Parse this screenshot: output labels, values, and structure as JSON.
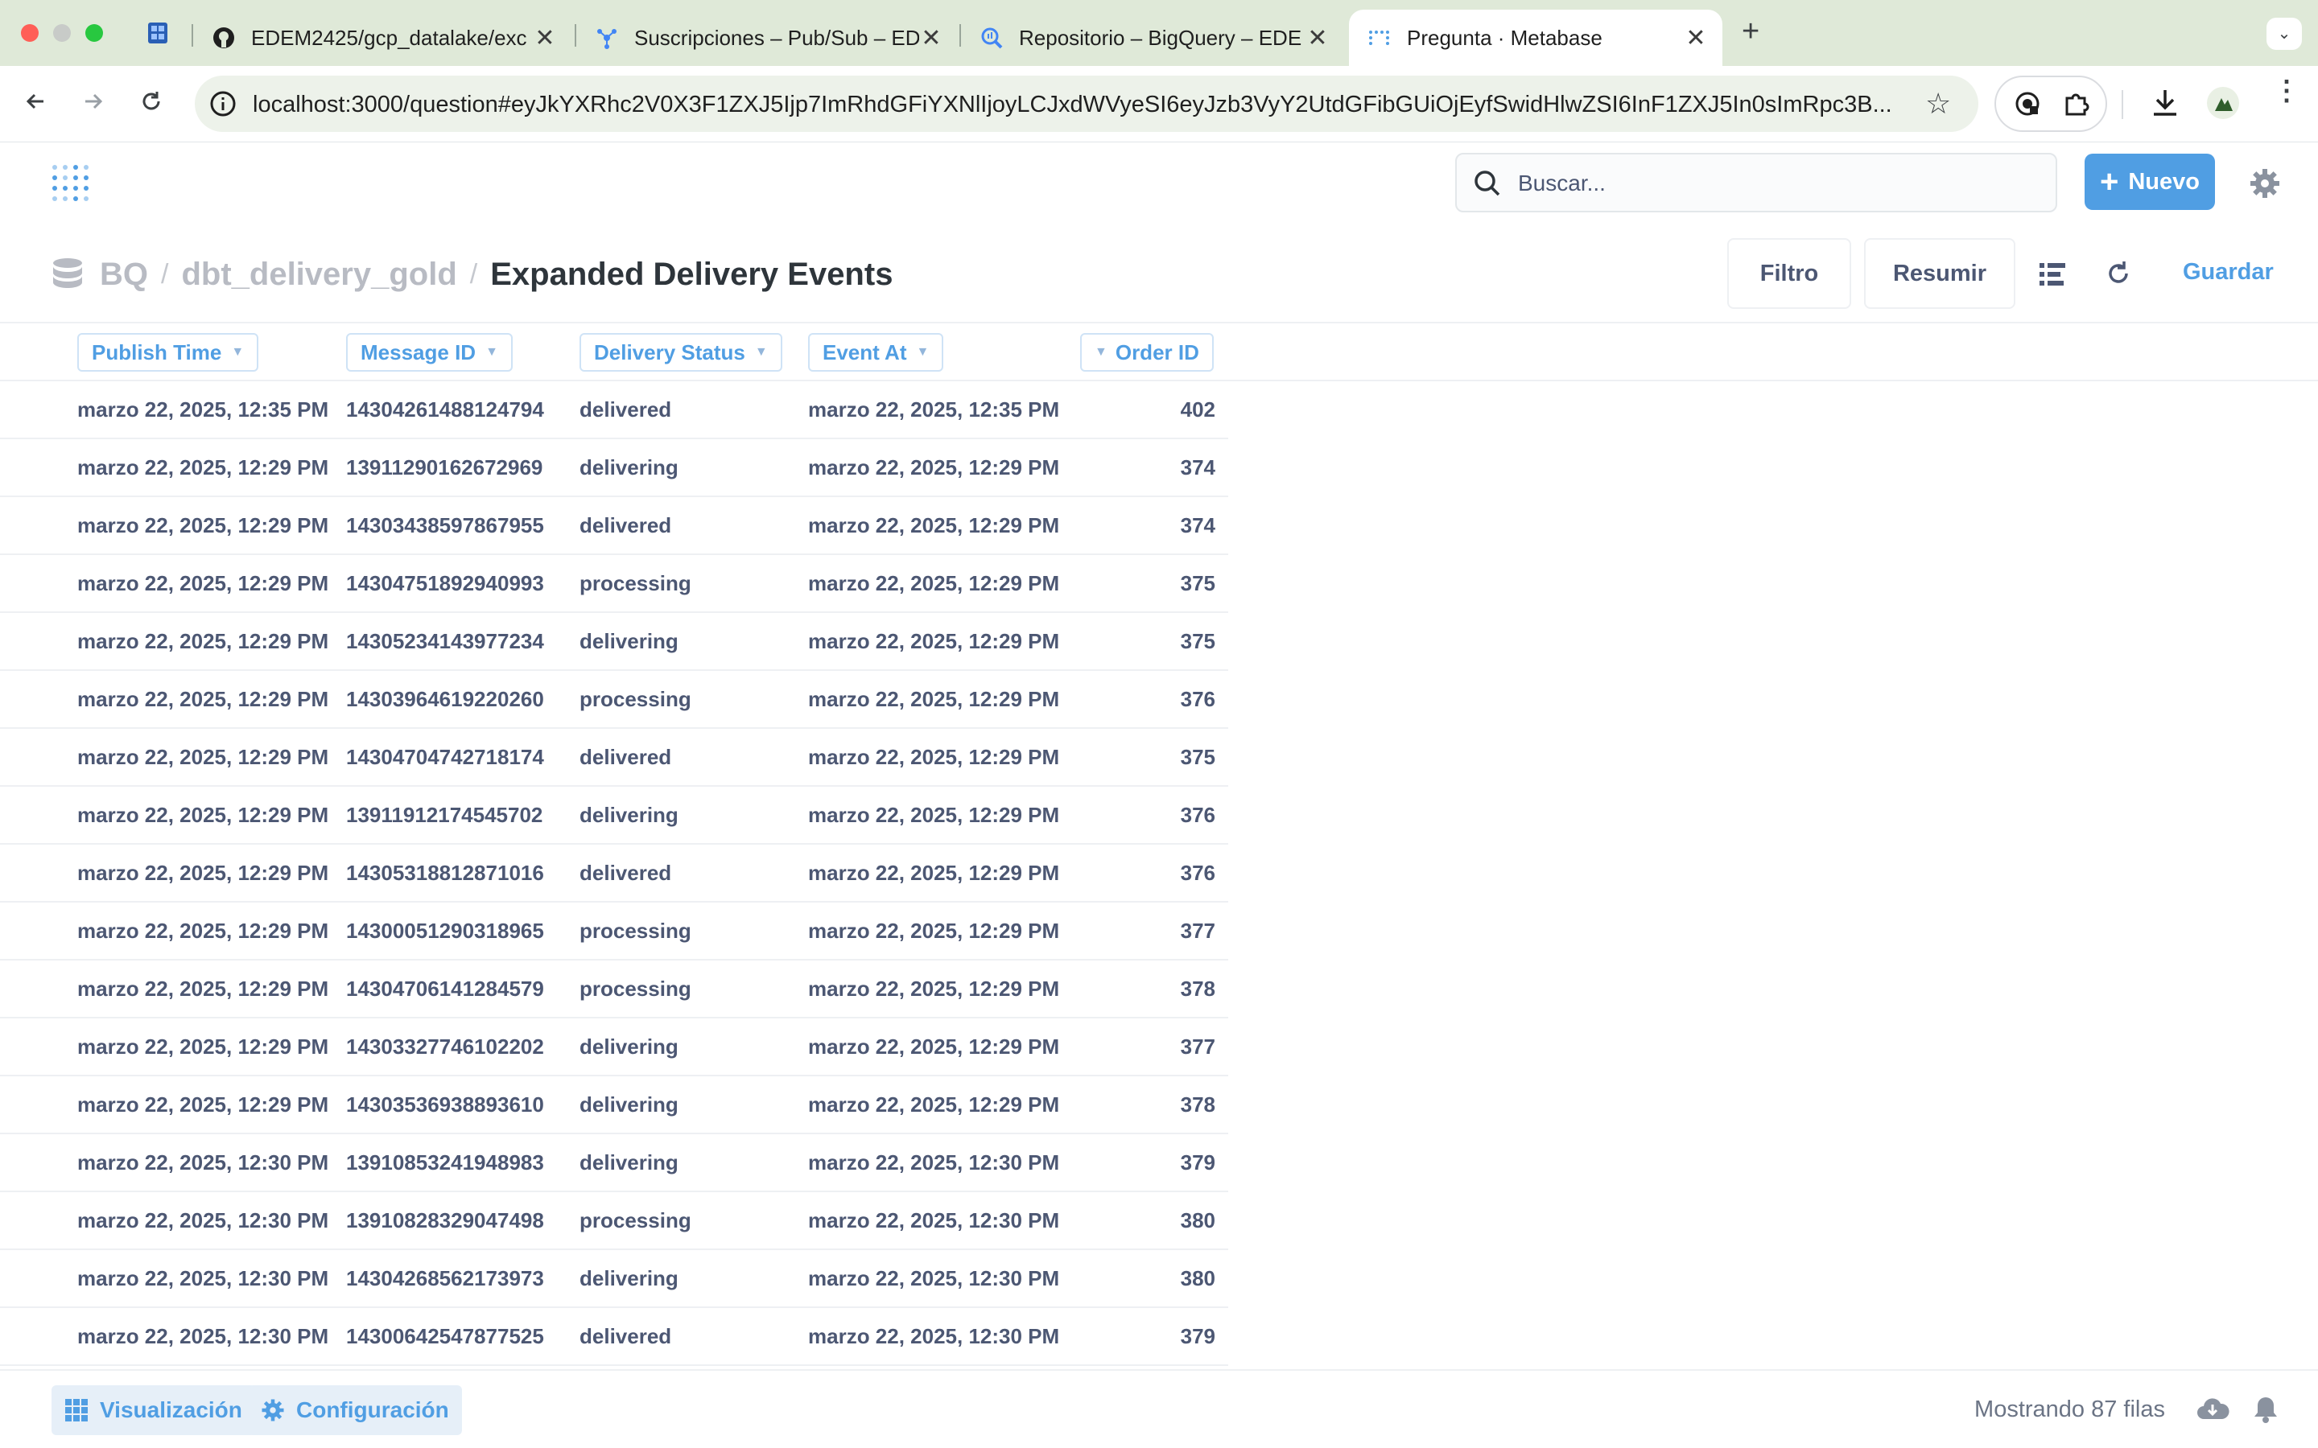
{
  "browser": {
    "tabs": [
      {
        "title": "EDEM2425/gcp_datalake/exc",
        "icon": "github-icon"
      },
      {
        "title": "Suscripciones – Pub/Sub – ED",
        "icon": "pubsub-icon"
      },
      {
        "title": "Repositorio – BigQuery – EDE",
        "icon": "bigquery-icon"
      },
      {
        "title": "Pregunta · Metabase",
        "icon": "metabase-icon",
        "active": true
      }
    ],
    "url": "localhost:3000/question#eyJkYXRhc2V0X3F1ZXJ5Ijp7ImRhdGFiYXNlIjoyLCJxdWVyeSI6eyJzb3VyY2UtdGFibGUiOjEyfSwidHlwZSI6InF1ZXJ5In0sImRpc3B..."
  },
  "header": {
    "search_placeholder": "Buscar...",
    "new_button": "Nuevo"
  },
  "breadcrumb": {
    "database": "BQ",
    "schema": "dbt_delivery_gold",
    "title": "Expanded Delivery Events"
  },
  "actions": {
    "filter": "Filtro",
    "summarize": "Resumir",
    "save": "Guardar"
  },
  "table": {
    "columns": [
      "Publish Time",
      "Message ID",
      "Delivery Status",
      "Event At",
      "Order ID"
    ],
    "rows": [
      [
        "marzo 22, 2025, 12:35 PM",
        "14304261488124794",
        "delivered",
        "marzo 22, 2025, 12:35 PM",
        "402"
      ],
      [
        "marzo 22, 2025, 12:29 PM",
        "13911290162672969",
        "delivering",
        "marzo 22, 2025, 12:29 PM",
        "374"
      ],
      [
        "marzo 22, 2025, 12:29 PM",
        "14303438597867955",
        "delivered",
        "marzo 22, 2025, 12:29 PM",
        "374"
      ],
      [
        "marzo 22, 2025, 12:29 PM",
        "14304751892940993",
        "processing",
        "marzo 22, 2025, 12:29 PM",
        "375"
      ],
      [
        "marzo 22, 2025, 12:29 PM",
        "14305234143977234",
        "delivering",
        "marzo 22, 2025, 12:29 PM",
        "375"
      ],
      [
        "marzo 22, 2025, 12:29 PM",
        "14303964619220260",
        "processing",
        "marzo 22, 2025, 12:29 PM",
        "376"
      ],
      [
        "marzo 22, 2025, 12:29 PM",
        "14304704742718174",
        "delivered",
        "marzo 22, 2025, 12:29 PM",
        "375"
      ],
      [
        "marzo 22, 2025, 12:29 PM",
        "13911912174545702",
        "delivering",
        "marzo 22, 2025, 12:29 PM",
        "376"
      ],
      [
        "marzo 22, 2025, 12:29 PM",
        "14305318812871016",
        "delivered",
        "marzo 22, 2025, 12:29 PM",
        "376"
      ],
      [
        "marzo 22, 2025, 12:29 PM",
        "14300051290318965",
        "processing",
        "marzo 22, 2025, 12:29 PM",
        "377"
      ],
      [
        "marzo 22, 2025, 12:29 PM",
        "14304706141284579",
        "processing",
        "marzo 22, 2025, 12:29 PM",
        "378"
      ],
      [
        "marzo 22, 2025, 12:29 PM",
        "14303327746102202",
        "delivering",
        "marzo 22, 2025, 12:29 PM",
        "377"
      ],
      [
        "marzo 22, 2025, 12:29 PM",
        "14303536938893610",
        "delivering",
        "marzo 22, 2025, 12:29 PM",
        "378"
      ],
      [
        "marzo 22, 2025, 12:30 PM",
        "13910853241948983",
        "delivering",
        "marzo 22, 2025, 12:30 PM",
        "379"
      ],
      [
        "marzo 22, 2025, 12:30 PM",
        "13910828329047498",
        "processing",
        "marzo 22, 2025, 12:30 PM",
        "380"
      ],
      [
        "marzo 22, 2025, 12:30 PM",
        "14304268562173973",
        "delivering",
        "marzo 22, 2025, 12:30 PM",
        "380"
      ],
      [
        "marzo 22, 2025, 12:30 PM",
        "14300642547877525",
        "delivered",
        "marzo 22, 2025, 12:30 PM",
        "379"
      ]
    ]
  },
  "footer": {
    "visualization": "Visualización",
    "settings": "Configuración",
    "row_count": "Mostrando 87 filas"
  },
  "colors": {
    "brand": "#509ee3",
    "text": "#4c5773",
    "tabstrip": "#dfe9d8"
  }
}
